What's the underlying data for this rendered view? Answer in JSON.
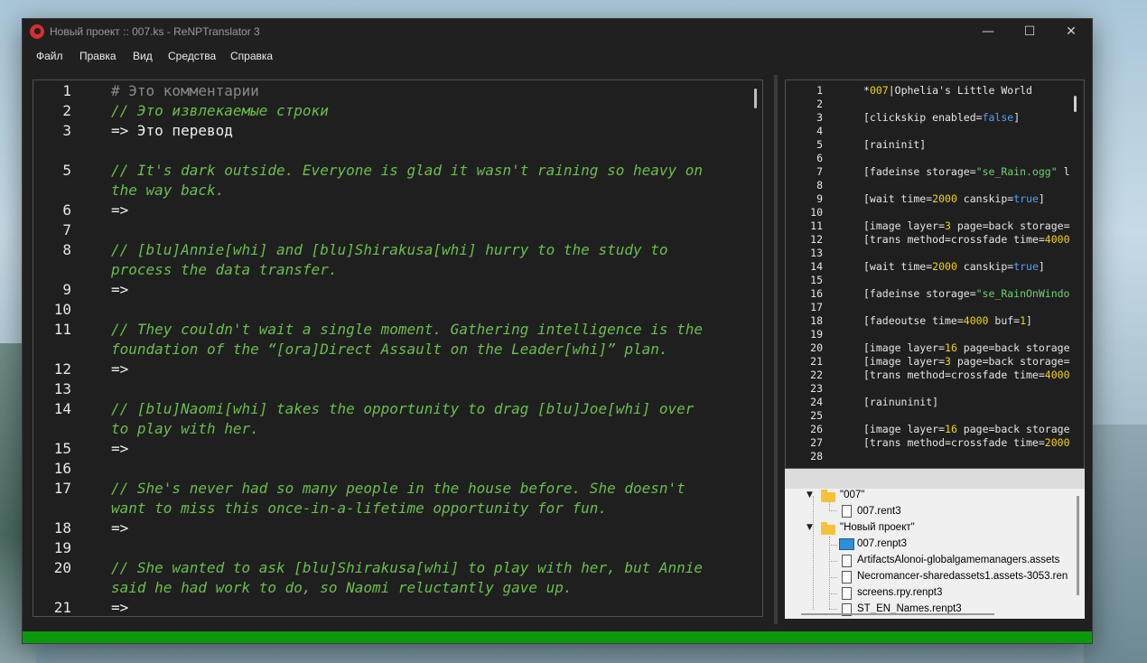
{
  "window": {
    "title": "Новый проект :: 007.ks - ReNPTranslator 3"
  },
  "window_controls": {
    "minimize": "—",
    "maximize": "☐",
    "close": "✕"
  },
  "menu": [
    "Файл",
    "Правка",
    "Вид",
    "Средства",
    "Справка"
  ],
  "editor": {
    "lines": [
      {
        "num": "1",
        "text": "# Это комментарии",
        "style": "gray"
      },
      {
        "num": "2",
        "text": "// Это извлекаемые строки",
        "style": "green"
      },
      {
        "num": "3",
        "text": "=> Это перевод",
        "style": "white"
      },
      {
        "num": "",
        "text": "",
        "style": "white"
      },
      {
        "num": "5",
        "text": "// It's dark outside. Everyone is glad it wasn't raining so heavy on",
        "style": "green"
      },
      {
        "num": "",
        "text": "the way back.",
        "style": "green"
      },
      {
        "num": "6",
        "text": "=>",
        "style": "white"
      },
      {
        "num": "7",
        "text": "",
        "style": "white"
      },
      {
        "num": "8",
        "text": "// [blu]Annie[whi] and [blu]Shirakusa[whi] hurry to the study to",
        "style": "green"
      },
      {
        "num": "",
        "text": "process the data transfer.",
        "style": "green"
      },
      {
        "num": "9",
        "text": "=>",
        "style": "white"
      },
      {
        "num": "10",
        "text": "",
        "style": "white"
      },
      {
        "num": "11",
        "text": "// They couldn't wait a single moment. Gathering intelligence is the",
        "style": "green"
      },
      {
        "num": "",
        "text": "foundation of the “[ora]Direct Assault on the Leader[whi]” plan.",
        "style": "green"
      },
      {
        "num": "12",
        "text": "=>",
        "style": "white"
      },
      {
        "num": "13",
        "text": "",
        "style": "white"
      },
      {
        "num": "14",
        "text": "// [blu]Naomi[whi] takes the opportunity to drag [blu]Joe[whi] over",
        "style": "green"
      },
      {
        "num": "",
        "text": "to play with her.",
        "style": "green"
      },
      {
        "num": "15",
        "text": "=>",
        "style": "white"
      },
      {
        "num": "16",
        "text": "",
        "style": "white"
      },
      {
        "num": "17",
        "text": "// She's never had so many people in the house before. She doesn't",
        "style": "green"
      },
      {
        "num": "",
        "text": "want to miss this once-in-a-lifetime opportunity for fun.",
        "style": "green"
      },
      {
        "num": "18",
        "text": "=>",
        "style": "white"
      },
      {
        "num": "19",
        "text": "",
        "style": "white"
      },
      {
        "num": "20",
        "text": "// She wanted to ask [blu]Shirakusa[whi] to play with her, but Annie",
        "style": "green"
      },
      {
        "num": "",
        "text": "said he had work to do, so Naomi reluctantly gave up.",
        "style": "green"
      },
      {
        "num": "21",
        "text": "=>",
        "style": "white"
      }
    ]
  },
  "source": {
    "lines": [
      {
        "num": "1",
        "segs": [
          [
            "*",
            "w"
          ],
          [
            "007",
            "y"
          ],
          [
            "|Ophelia's Little World",
            "w"
          ]
        ]
      },
      {
        "num": "2",
        "segs": []
      },
      {
        "num": "3",
        "segs": [
          [
            "[clickskip enabled=",
            "w"
          ],
          [
            "false",
            "b"
          ],
          [
            "]",
            "w"
          ]
        ]
      },
      {
        "num": "4",
        "segs": []
      },
      {
        "num": "5",
        "segs": [
          [
            "[raininit]",
            "w"
          ]
        ]
      },
      {
        "num": "6",
        "segs": []
      },
      {
        "num": "7",
        "segs": [
          [
            "[fadeinse storage=",
            "w"
          ],
          [
            "\"se_Rain.ogg\"",
            "g"
          ],
          [
            " l",
            "w"
          ]
        ]
      },
      {
        "num": "8",
        "segs": []
      },
      {
        "num": "9",
        "segs": [
          [
            "[wait time=",
            "w"
          ],
          [
            "2000",
            "y"
          ],
          [
            " canskip=",
            "w"
          ],
          [
            "true",
            "b"
          ],
          [
            "]",
            "w"
          ]
        ]
      },
      {
        "num": "10",
        "segs": []
      },
      {
        "num": "11",
        "segs": [
          [
            "[image layer=",
            "w"
          ],
          [
            "3",
            "y"
          ],
          [
            " page=back storage=",
            "w"
          ]
        ]
      },
      {
        "num": "12",
        "segs": [
          [
            "[trans method=crossfade time=",
            "w"
          ],
          [
            "4000",
            "y"
          ]
        ]
      },
      {
        "num": "13",
        "segs": []
      },
      {
        "num": "14",
        "segs": [
          [
            "[wait time=",
            "w"
          ],
          [
            "2000",
            "y"
          ],
          [
            " canskip=",
            "w"
          ],
          [
            "true",
            "b"
          ],
          [
            "]",
            "w"
          ]
        ]
      },
      {
        "num": "15",
        "segs": []
      },
      {
        "num": "16",
        "segs": [
          [
            "[fadeinse storage=",
            "w"
          ],
          [
            "\"se_RainOnWindo",
            "g"
          ]
        ]
      },
      {
        "num": "17",
        "segs": []
      },
      {
        "num": "18",
        "segs": [
          [
            "[fadeoutse time=",
            "w"
          ],
          [
            "4000",
            "y"
          ],
          [
            " buf=",
            "w"
          ],
          [
            "1",
            "y"
          ],
          [
            "]",
            "w"
          ]
        ]
      },
      {
        "num": "19",
        "segs": []
      },
      {
        "num": "20",
        "segs": [
          [
            "[image layer=",
            "w"
          ],
          [
            "16",
            "y"
          ],
          [
            " page=back storage",
            "w"
          ]
        ]
      },
      {
        "num": "21",
        "segs": [
          [
            "[image layer=",
            "w"
          ],
          [
            "3",
            "y"
          ],
          [
            " page=back storage=",
            "w"
          ]
        ]
      },
      {
        "num": "22",
        "segs": [
          [
            "[trans method=crossfade time=",
            "w"
          ],
          [
            "4000",
            "y"
          ]
        ]
      },
      {
        "num": "23",
        "segs": []
      },
      {
        "num": "24",
        "segs": [
          [
            "[rainuninit]",
            "w"
          ]
        ]
      },
      {
        "num": "25",
        "segs": []
      },
      {
        "num": "26",
        "segs": [
          [
            "[image layer=",
            "w"
          ],
          [
            "16",
            "y"
          ],
          [
            " page=back storage",
            "w"
          ]
        ]
      },
      {
        "num": "27",
        "segs": [
          [
            "[trans method=crossfade time=",
            "w"
          ],
          [
            "2000",
            "y"
          ]
        ]
      },
      {
        "num": "28",
        "segs": []
      }
    ]
  },
  "tree": {
    "folder1": "\"007\"",
    "file1": "007.rent3",
    "folder2": "\"Новый проект\"",
    "items": [
      "007.renpt3",
      "ArtifactsAlonoi-globalgamemanagers.assets",
      "Necromancer-sharedassets1.assets-3053.ren",
      "screens.rpy.renpt3",
      "ST_EN_Names.renpt3"
    ]
  },
  "colors": {
    "comment_gray": "#8a8a8a",
    "string_green": "#6abf4b",
    "translation_white": "#efefef",
    "number_yellow": "#f5d400",
    "keyword_blue": "#4ea1ff",
    "status_green": "#0c9a0c"
  }
}
